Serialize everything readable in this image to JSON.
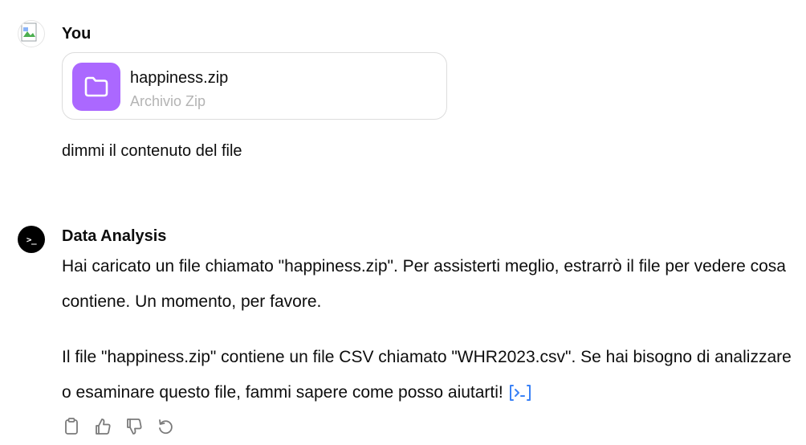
{
  "user_message": {
    "author": "You",
    "avatar_icon": "broken-image-icon",
    "attachment": {
      "name": "happiness.zip",
      "type": "Archivio Zip",
      "icon": "folder-icon",
      "icon_bg": "#ab68ff"
    },
    "text": "dimmi il contenuto del file"
  },
  "assistant_message": {
    "author": "Data Analysis",
    "avatar_icon": "terminal-icon",
    "avatar_glyph": ">_",
    "paragraphs": [
      "Hai caricato un file chiamato \"happiness.zip\". Per assisterti meglio, estrarrò il file per vedere cosa contiene. Un momento, per favore.",
      "Il file \"happiness.zip\" contiene un file CSV chiamato \"WHR2023.csv\". Se hai bisogno di analizzare o esaminare questo file, fammi sapere come posso aiutarti!"
    ],
    "code_link_icon": "view-analysis-icon",
    "code_link_color": "#3b82f6",
    "actions": [
      {
        "icon": "clipboard-icon"
      },
      {
        "icon": "thumbs-up-icon"
      },
      {
        "icon": "thumbs-down-icon"
      },
      {
        "icon": "regenerate-icon"
      }
    ]
  }
}
